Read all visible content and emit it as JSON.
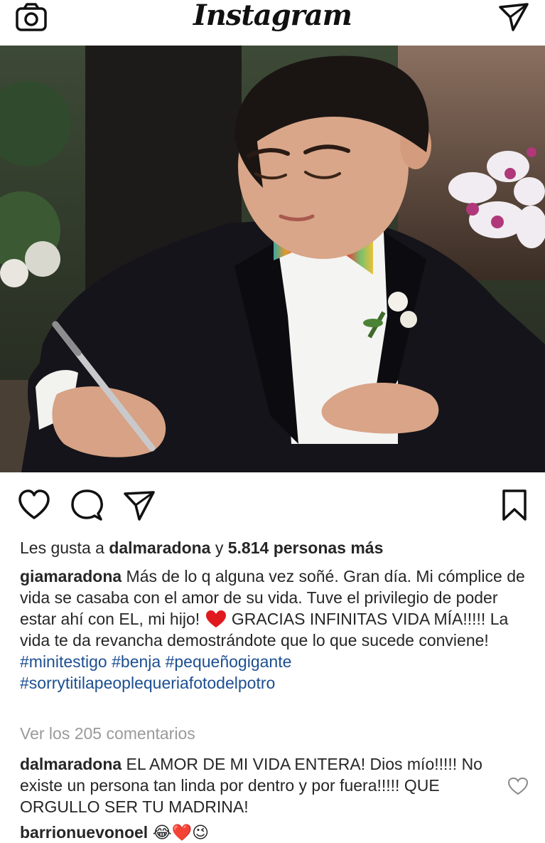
{
  "header": {
    "title": "Instagram",
    "camera_icon": "camera-icon",
    "send_icon": "paper-plane-icon"
  },
  "post": {
    "image_alt": "Boy in black suit and colorful bow tie signing a document",
    "actions": {
      "like_icon": "heart-outline-icon",
      "comment_icon": "speech-bubble-icon",
      "share_icon": "paper-plane-icon",
      "save_icon": "bookmark-icon"
    },
    "likes": {
      "prefix": "Les gusta a ",
      "user": "dalmaradona",
      "middle": " y ",
      "count": "5.814 personas más"
    },
    "caption": {
      "user": "giamaradona",
      "text_1": " Más de lo q alguna vez soñé. Gran día. Mi cómplice de vida se casaba con el amor de su vida. Tuve el privilegio de poder estar ahí con EL, mi hijo! ",
      "text_2": " GRACIAS INFINITAS VIDA MÍA!!!!! La vida te da revancha demostrándote que lo que sucede conviene! ",
      "tag_1": "#minitestigo",
      "tag_2": "#benja",
      "tag_3": "#pequeñogigante",
      "tag_4": "#sorrytitilapeoplequeriafotodelpotro"
    },
    "view_comments": "Ver los 205 comentarios",
    "comments": [
      {
        "user": "dalmaradona",
        "text": " EL AMOR DE MI VIDA ENTERA! Dios mío!!!!! No existe un persona tan linda por dentro y por fuera!!!!! QUE ORGULLO SER TU MADRINA!"
      },
      {
        "user": "barrionuevonoel",
        "text": " 😂❤️😉"
      }
    ]
  },
  "colors": {
    "hashtag": "#1d4f91",
    "muted": "#9a9a9a",
    "heart": "#e0191f"
  }
}
